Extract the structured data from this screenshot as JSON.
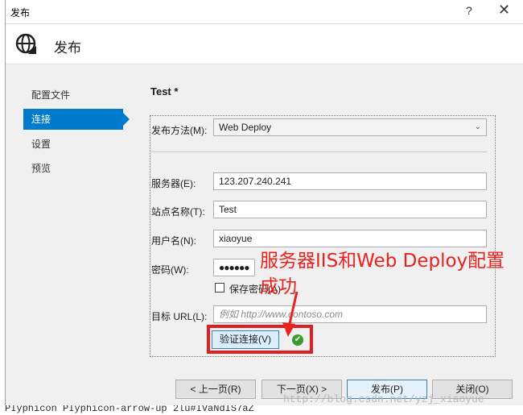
{
  "window": {
    "title": "发布",
    "help_glyph": "?",
    "close_glyph": "✕"
  },
  "header": {
    "title": "发布"
  },
  "nav": {
    "items": [
      {
        "label": "配置文件",
        "active": false
      },
      {
        "label": "连接",
        "active": true
      },
      {
        "label": "设置",
        "active": false
      },
      {
        "label": "预览",
        "active": false
      }
    ]
  },
  "profile": {
    "title": "Test *"
  },
  "form": {
    "method_label": "发布方法(M):",
    "method_value": "Web Deploy",
    "server_label": "服务器(E):",
    "server_value": "123.207.240.241",
    "site_label": "站点名称(T):",
    "site_value": "Test",
    "user_label": "用户名(N):",
    "user_value": "xiaoyue",
    "password_label": "密码(W):",
    "password_value": "●●●●●●",
    "save_password_label": "保存密码(A)",
    "url_label": "目标 URL(L):",
    "url_placeholder": "例如 http://www.contoso.com",
    "verify_label": "验证连接(V)"
  },
  "annotation": {
    "text": "服务器IIS和Web Deploy配置成功"
  },
  "footer": {
    "prev_label": "< 上一页(R)",
    "next_label": "下一页(X) >",
    "publish_label": "发布(P)",
    "close_label": "关闭(O)"
  },
  "watermark": "http://blog.csdn.net/yzj_xiaoyue",
  "background": {
    "code_line": "PIyphicon PIyphicon-arrow-up 2lu#IVaNdIS7aZ"
  },
  "colors": {
    "accent": "#007acc",
    "annotation": "#e8231f",
    "success": "#3a9a2e"
  }
}
